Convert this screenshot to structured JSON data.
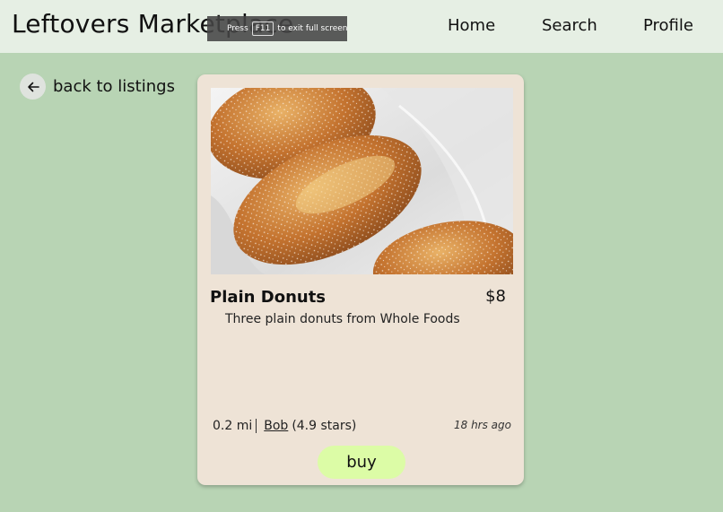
{
  "header": {
    "brand": "Leftovers Marketplace",
    "nav": {
      "home": "Home",
      "search": "Search",
      "profile": "Profile"
    }
  },
  "fullscreen_notice": {
    "press": "Press",
    "key": "F11",
    "rest": "to exit full screen"
  },
  "back": {
    "label": "back to listings",
    "icon": "arrow-left-icon"
  },
  "listing": {
    "image": "donuts-photo",
    "title": "Plain Donuts",
    "price": "$8",
    "description": "Three plain donuts from Whole Foods",
    "distance": "0.2 mi",
    "seller": "Bob",
    "rating": "(4.9 stars)",
    "posted": "18 hrs ago",
    "buy_label": "buy"
  },
  "colors": {
    "background": "#b8d4b4",
    "header": "#e6efe4",
    "card": "#eee3d6",
    "buy_button": "#dcfca6"
  }
}
